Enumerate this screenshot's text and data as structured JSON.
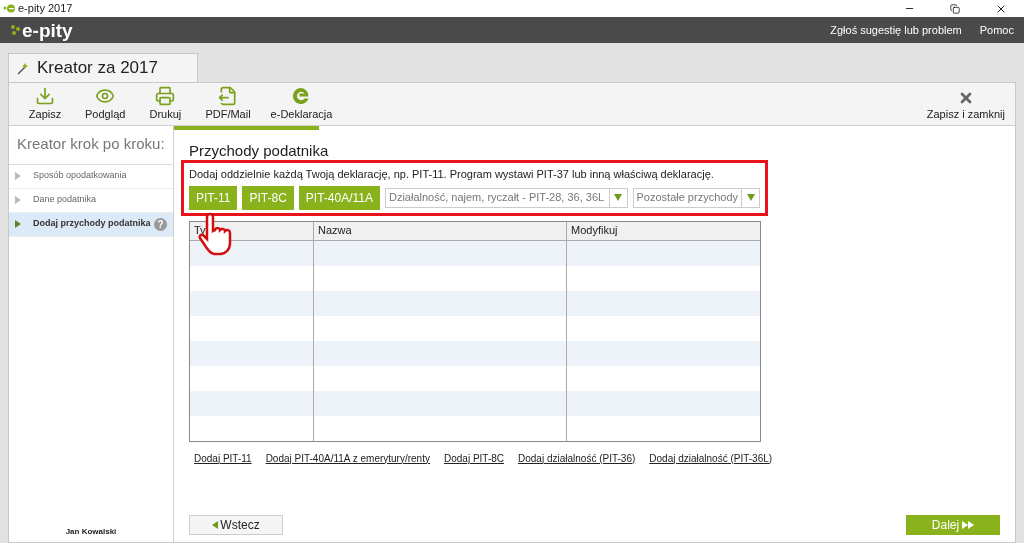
{
  "window": {
    "title": "e-pity 2017"
  },
  "header": {
    "logo": "e-pity",
    "links": [
      "Zgłoś sugestię lub problem",
      "Pomoc"
    ]
  },
  "tab": {
    "label": "Kreator za 2017"
  },
  "toolbar": {
    "items": [
      {
        "kind": "save",
        "label": "Zapisz"
      },
      {
        "kind": "preview",
        "label": "Podgląd"
      },
      {
        "kind": "print",
        "label": "Drukuj"
      },
      {
        "kind": "pdf",
        "label": "PDF/Mail"
      },
      {
        "kind": "edeclaration",
        "label": "e-Deklaracja"
      }
    ],
    "close": {
      "label": "Zapisz i zamknij"
    }
  },
  "sidebar": {
    "title": "Kreator krok po kroku:",
    "items": [
      {
        "label": "Sposób opodatkowania",
        "selected": false
      },
      {
        "label": "Dane podatnika",
        "selected": false
      },
      {
        "label": "Dodaj przychody podatnika",
        "selected": true,
        "help": "?"
      }
    ],
    "user": "Jan Kowalski"
  },
  "main": {
    "title": "Przychody podatnika",
    "hint": "Dodaj oddzielnie każdą Twoją deklarację, np. PIT-11. Program wystawi PIT-37 lub inną właściwą deklarację.",
    "buttons": [
      "PIT-11",
      "PIT-8C",
      "PIT-40A/11A"
    ],
    "dropdowns": [
      "Działalność, najem, ryczałt - PIT-28, 36, 36L",
      "Pozostałe przychody"
    ],
    "table": {
      "columns": [
        "Ty",
        "Nazwa",
        "Modyfikuj"
      ]
    },
    "links": [
      "Dodaj PIT-11",
      "Dodaj PIT-40A/11A z emerytury/renty",
      "Dodaj PIT-8C",
      "Dodaj działalność (PIT-36)",
      "Dodaj działalność (PIT-36L)"
    ],
    "back": "Wstecz",
    "next": "Dalej"
  }
}
